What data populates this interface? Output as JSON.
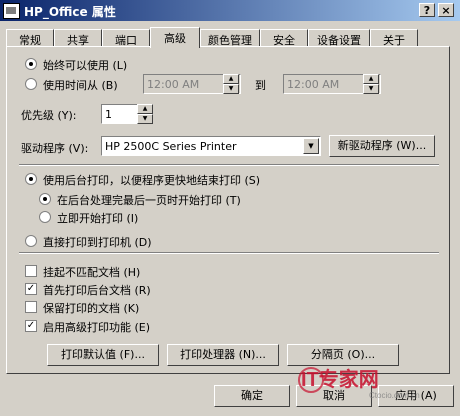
{
  "window": {
    "title": "HP_Office 属性",
    "help_glyph": "?",
    "close_glyph": "×"
  },
  "tabs": [
    "常规",
    "共享",
    "端口",
    "高级",
    "颜色管理",
    "安全",
    "设备设置",
    "关于"
  ],
  "availability": {
    "always_label": "始终可以使用 (L)",
    "from_label": "使用时间从 (B)",
    "from_time": "12:00 AM",
    "to_label": "到",
    "to_time": "12:00 AM"
  },
  "priority": {
    "label": "优先级 (Y):",
    "value": "1"
  },
  "driver": {
    "label": "驱动程序 (V):",
    "value": "HP 2500C Series Printer",
    "new_button": "新驱动程序 (W)..."
  },
  "spool": {
    "spool_label": "使用后台打印，以便程序更快地结束打印 (S)",
    "after_last_page": "在后台处理完最后一页时开始打印 (T)",
    "immediately": "立即开始打印 (I)",
    "direct": "直接打印到打印机 (D)"
  },
  "options": [
    {
      "label": "挂起不匹配文档 (H)",
      "checked": false
    },
    {
      "label": "首先打印后台文档 (R)",
      "checked": true
    },
    {
      "label": "保留打印的文档 (K)",
      "checked": false
    },
    {
      "label": "启用高级打印功能 (E)",
      "checked": true
    }
  ],
  "lower_buttons": {
    "defaults": "打印默认值 (F)...",
    "processor": "打印处理器 (N)...",
    "separator": "分隔页 (O)..."
  },
  "dialog_buttons": {
    "ok": "确定",
    "cancel": "取消",
    "apply": "应用 (A)"
  },
  "watermark": {
    "brand": "IT专家网",
    "site": "Ctocio.com.cn"
  },
  "colors": {
    "titlebar": "#0a246a",
    "face": "#d4d0c8",
    "watermark": "#c8102e"
  }
}
